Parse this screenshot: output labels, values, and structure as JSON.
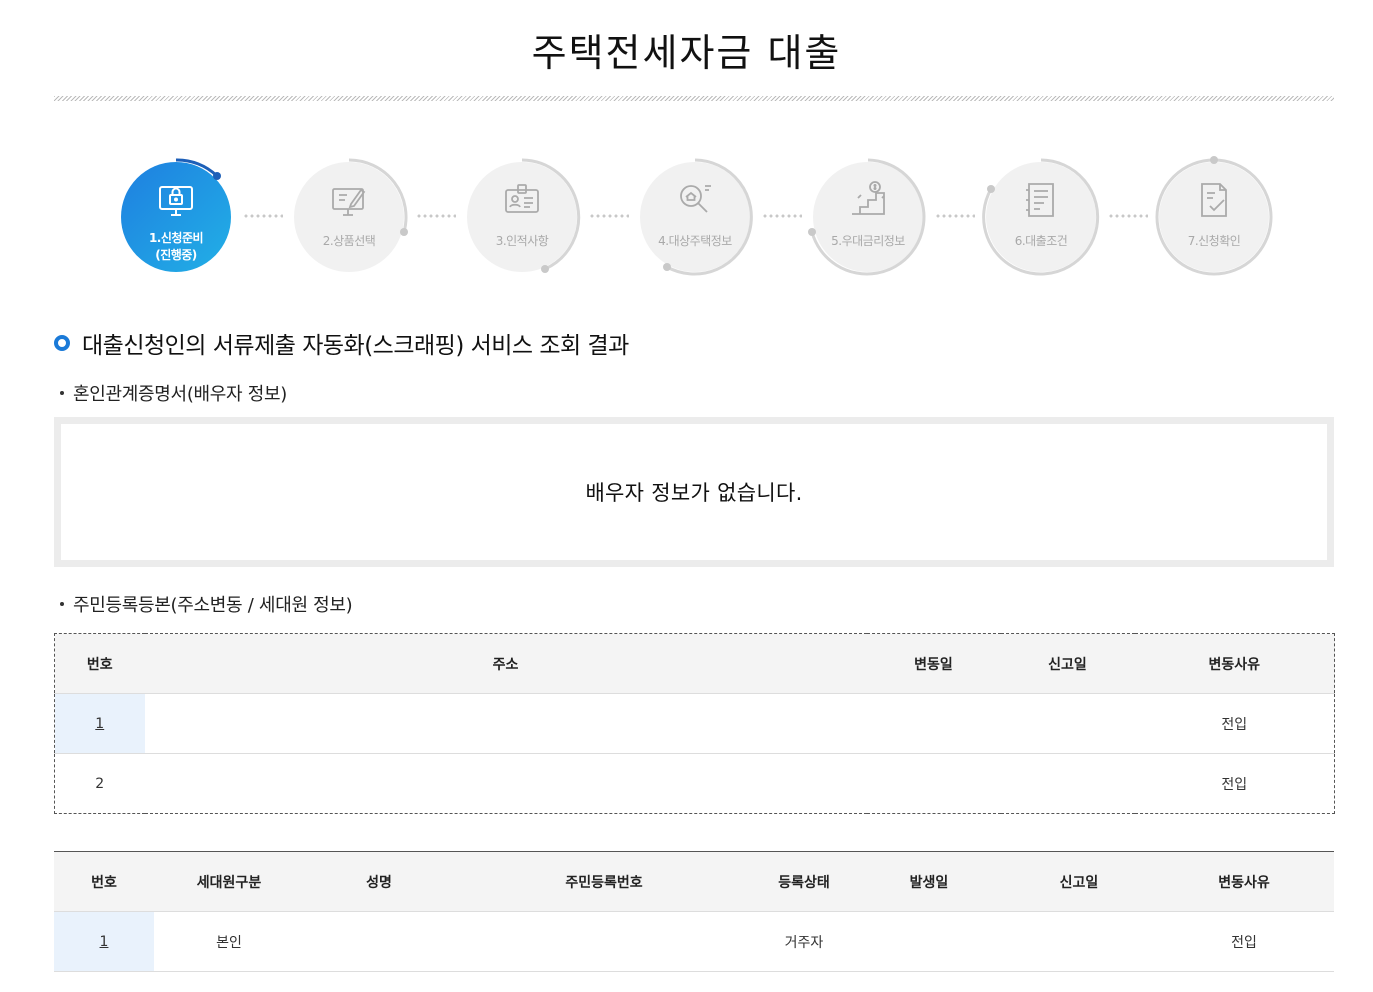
{
  "page": {
    "title": "주택전세자금 대출"
  },
  "steps": [
    {
      "label": "1.신청준비",
      "sub": "(진행중)",
      "icon": "computer-lock-icon",
      "active": true
    },
    {
      "label": "2.상품선택",
      "icon": "product-select-icon",
      "active": false
    },
    {
      "label": "3.인적사항",
      "icon": "id-card-icon",
      "active": false
    },
    {
      "label": "4.대상주택정보",
      "icon": "house-search-icon",
      "active": false
    },
    {
      "label": "5.우대금리정보",
      "icon": "rate-stairs-icon",
      "active": false
    },
    {
      "label": "6.대출조건",
      "icon": "document-list-icon",
      "active": false
    },
    {
      "label": "7.신청확인",
      "icon": "document-check-icon",
      "active": false
    }
  ],
  "section": {
    "title": "대출신청인의 서류제출 자동화(스크래핑) 서비스 조회 결과"
  },
  "marriage": {
    "heading": "혼인관계증명서(배우자 정보)",
    "empty_message": "배우자 정보가 없습니다."
  },
  "residence": {
    "heading": "주민등록등본(주소변동 / 세대원 정보)",
    "address_table": {
      "headers": [
        "번호",
        "주소",
        "변동일",
        "신고일",
        "변동사유"
      ],
      "rows": [
        {
          "no": "1",
          "address": "",
          "change_date": "",
          "report_date": "",
          "reason": "전입"
        },
        {
          "no": "2",
          "address": "",
          "change_date": "",
          "report_date": "",
          "reason": "전입"
        }
      ]
    },
    "member_table": {
      "headers": [
        "번호",
        "세대원구분",
        "성명",
        "주민등록번호",
        "등록상태",
        "발생일",
        "신고일",
        "변동사유"
      ],
      "rows": [
        {
          "no": "1",
          "type": "본인",
          "name": "",
          "rrn": "",
          "status": "거주자",
          "occur_date": "",
          "report_date": "",
          "reason": "전입"
        }
      ]
    }
  },
  "colors": {
    "accent": "#1a7ad8",
    "active_gradient_start": "#1e7fe0",
    "active_gradient_end": "#22b0e6"
  }
}
